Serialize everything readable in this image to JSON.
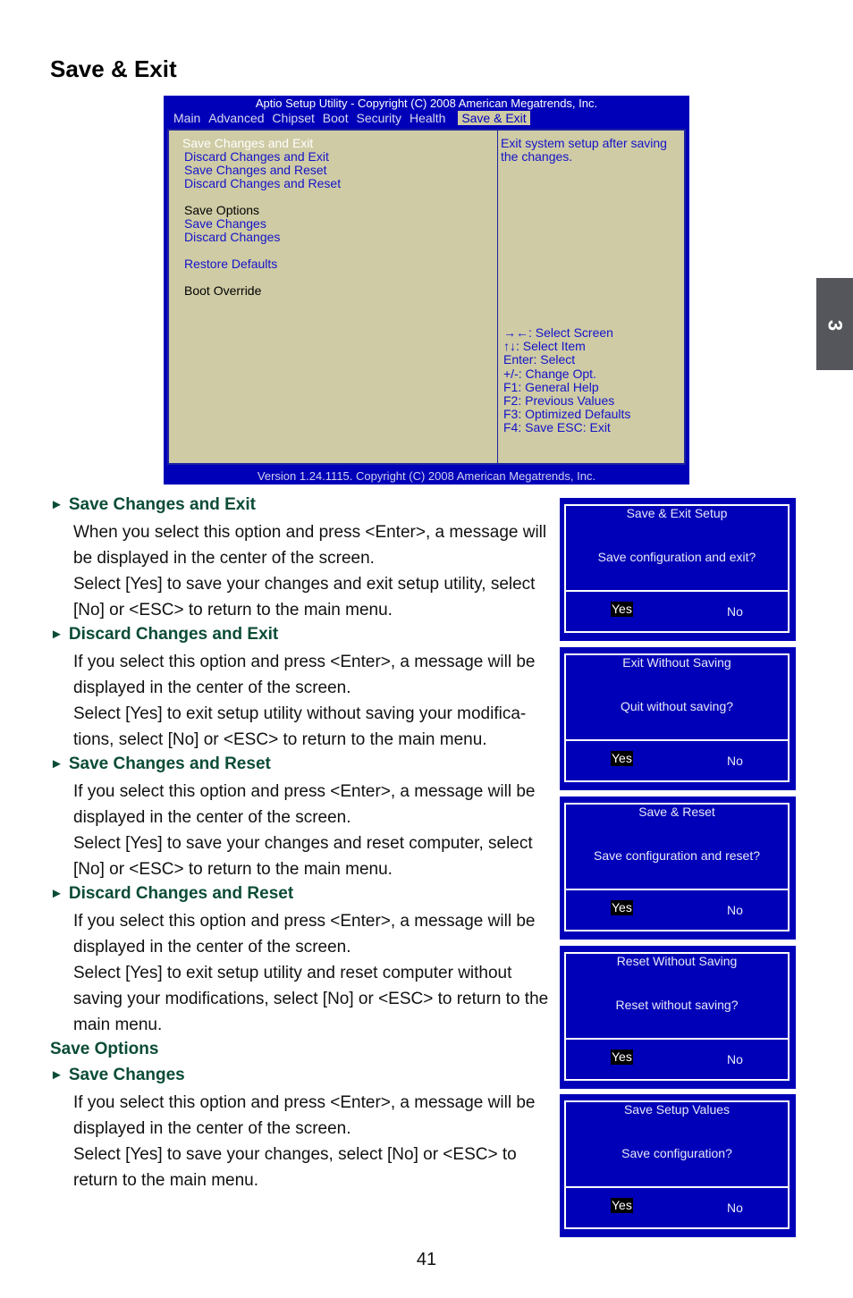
{
  "page_title": "Save & Exit",
  "chapter_tab": "3",
  "page_number": "41",
  "bios": {
    "title": "Aptio Setup Utility - Copyright (C) 2008 American Megatrends, Inc.",
    "tabs": [
      "Main",
      "Advanced",
      "Chipset",
      "Boot",
      "Security",
      "Health",
      "Save & Exit"
    ],
    "active_tab": "Save & Exit",
    "menu": {
      "save_changes_exit": "Save Changes and Exit",
      "discard_changes_exit": "Discard Changes and Exit",
      "save_changes_reset": "Save Changes and Reset",
      "discard_changes_reset": "Discard Changes and Reset",
      "save_options": "Save Options",
      "save_changes": "Save Changes",
      "discard_changes": "Discard Changes",
      "restore_defaults": "Restore Defaults",
      "boot_override": "Boot Override"
    },
    "help_text": "Exit system setup after saving the changes.",
    "keys": [
      "→←: Select Screen",
      "↑↓: Select Item",
      "Enter: Select",
      "+/-: Change Opt.",
      "F1: General Help",
      "F2: Previous Values",
      "F3: Optimized Defaults",
      "F4: Save  ESC: Exit"
    ],
    "footer": "Version 1.24.1115. Copyright (C) 2008 American Megatrends, Inc."
  },
  "sections": [
    {
      "heading": "Save Changes and Exit",
      "paragraphs": [
        "When you select this option and press <Enter>, a message will be displayed in the center of the screen.",
        "Select [Yes] to save your changes and exit setup utility, select [No] or <ESC> to return to the main menu."
      ]
    },
    {
      "heading": "Discard Changes and Exit",
      "paragraphs": [
        "If you select this option and press <Enter>,  a message will be displayed in the center of the screen.",
        "Select [Yes] to exit setup utility without saving your modifica-tions, select [No] or <ESC> to return to the main menu."
      ]
    },
    {
      "heading": "Save Changes and Reset",
      "paragraphs": [
        "If you select this option and press <Enter>, a message will be displayed in the center of the screen.",
        "Select [Yes] to save your changes and reset computer, select [No] or <ESC> to return to the main menu."
      ]
    },
    {
      "heading": "Discard Changes and Reset",
      "paragraphs": [
        "If you select this option and press <Enter>,  a message will be displayed in the center of the screen.",
        "Select [Yes] to exit setup utility and reset computer without saving your modifications, select [No] or <ESC> to return to the main menu."
      ]
    }
  ],
  "save_options": {
    "heading": "Save Options",
    "sub_heading": "Save Changes",
    "paragraphs": [
      "If you select this option and press <Enter>, a message will be displayed in the center of the screen.",
      "Select [Yes] to save your changes, select [No] or <ESC> to return to the main menu."
    ]
  },
  "dialogs": [
    {
      "title": "Save & Exit Setup",
      "message": "Save configuration and exit?",
      "yes": "Yes",
      "no": "No"
    },
    {
      "title": "Exit Without Saving",
      "message": "Quit without saving?",
      "yes": "Yes",
      "no": "No"
    },
    {
      "title": "Save & Reset",
      "message": "Save configuration and reset?",
      "yes": "Yes",
      "no": "No"
    },
    {
      "title": "Reset Without Saving",
      "message": "Reset without saving?",
      "yes": "Yes",
      "no": "No"
    },
    {
      "title": "Save Setup Values",
      "message": "Save configuration?",
      "yes": "Yes",
      "no": "No"
    }
  ],
  "colors": {
    "bios_blue": "#0000b8",
    "bios_panel": "#cfcba5",
    "bios_link": "#1414c8",
    "heading_green": "#0b4c35",
    "chapter_tab_gray": "#55565b"
  }
}
